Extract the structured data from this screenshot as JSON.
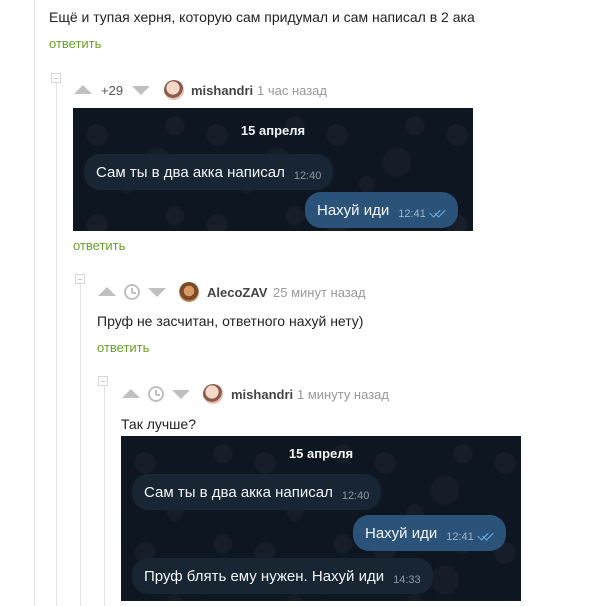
{
  "top_comment": {
    "text": "Ещё и тупая херня, которую сам придумал и сам написал в 2 ака",
    "reply_label": "ответить"
  },
  "comment1": {
    "rating": "+29",
    "author": "mishandri",
    "time": "1 час назад",
    "screenshot": {
      "date": "15 апреля",
      "messages": [
        {
          "text": "Сам ты в два акка написал",
          "time": "12:40",
          "direction": "incoming"
        },
        {
          "text": "Нахуй иди",
          "time": "12:41",
          "direction": "outgoing",
          "read": true
        }
      ]
    },
    "reply_label": "ответить"
  },
  "comment2": {
    "author": "AlecoZAV",
    "time": "25 минут назад",
    "text": "Пруф не засчитан, ответного нахуй нету)",
    "reply_label": "ответить"
  },
  "comment3": {
    "author": "mishandri",
    "time": "1 минуту назад",
    "text": "Так лучше?",
    "screenshot": {
      "date": "15 апреля",
      "messages": [
        {
          "text": "Сам ты в два акка написал",
          "time": "12:40",
          "direction": "incoming"
        },
        {
          "text": "Нахуй иди",
          "time": "12:41",
          "direction": "outgoing",
          "read": true
        },
        {
          "text": "Пруф блять ему нужен. Нахуй иди",
          "time": "14:33",
          "direction": "incoming"
        }
      ]
    }
  },
  "icons": {
    "vote_up": "triangle-up-icon",
    "vote_down": "triangle-down-icon",
    "rating_hidden": "clock-icon",
    "collapse": "minus-square-icon",
    "read_receipt": "double-check-icon"
  },
  "colors": {
    "reply_link": "#6aa028",
    "tg_background": "#0e1621",
    "tg_incoming": "#182533",
    "tg_outgoing": "#2b5278"
  }
}
